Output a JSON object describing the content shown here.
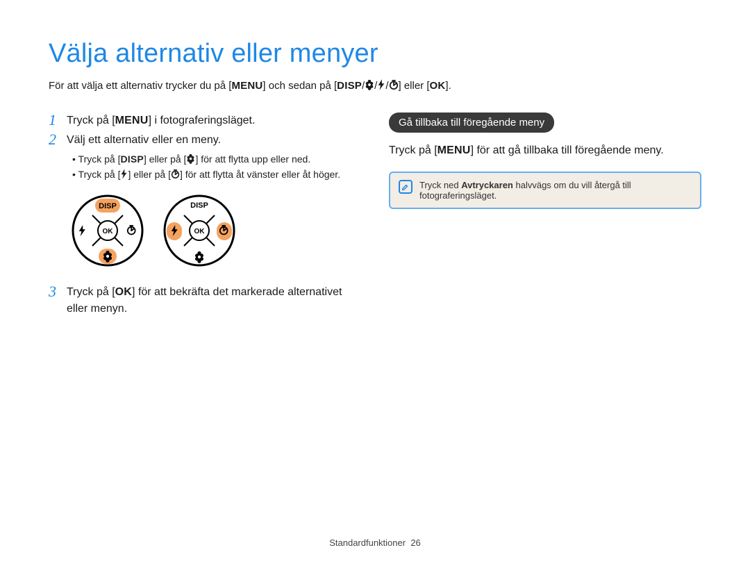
{
  "title": "Välja alternativ eller menyer",
  "intro": {
    "pre": "För att välja ett alternativ trycker du på [",
    "menu": "MENU",
    "mid1": "] och sedan på [",
    "disp": "DISP",
    "slash": "/",
    "mid2": "] eller [",
    "ok": "OK",
    "post": "]."
  },
  "left": {
    "step1": {
      "num": "1",
      "pre": "Tryck på [",
      "menu": "MENU",
      "post": "] i fotograferingsläget."
    },
    "step2": {
      "num": "2",
      "text": "Välj ett alternativ eller en meny.",
      "bullets": {
        "b1": {
          "pre": "Tryck på [",
          "disp": "DISP",
          "mid": "] eller på [",
          "post": "] för att flytta upp eller ned."
        },
        "b2": {
          "pre": "Tryck på [",
          "mid": "] eller på [",
          "post": "] för att flytta åt vänster eller åt höger."
        }
      }
    },
    "dial": {
      "disp": "DISP",
      "ok": "OK"
    },
    "step3": {
      "num": "3",
      "pre": "Tryck på [",
      "ok": "OK",
      "post": "] för att bekräfta det markerade alternativet eller menyn."
    }
  },
  "right": {
    "badge": "Gå tillbaka till föregående meny",
    "para": {
      "pre": "Tryck på [",
      "menu": "MENU",
      "post": "] för att gå tillbaka till föregående meny."
    },
    "note": {
      "pre": "Tryck ned ",
      "bold": "Avtryckaren",
      "post": " halvvägs om du vill återgå till fotograferingsläget."
    }
  },
  "footer": {
    "label": "Standardfunktioner",
    "page": "26"
  }
}
